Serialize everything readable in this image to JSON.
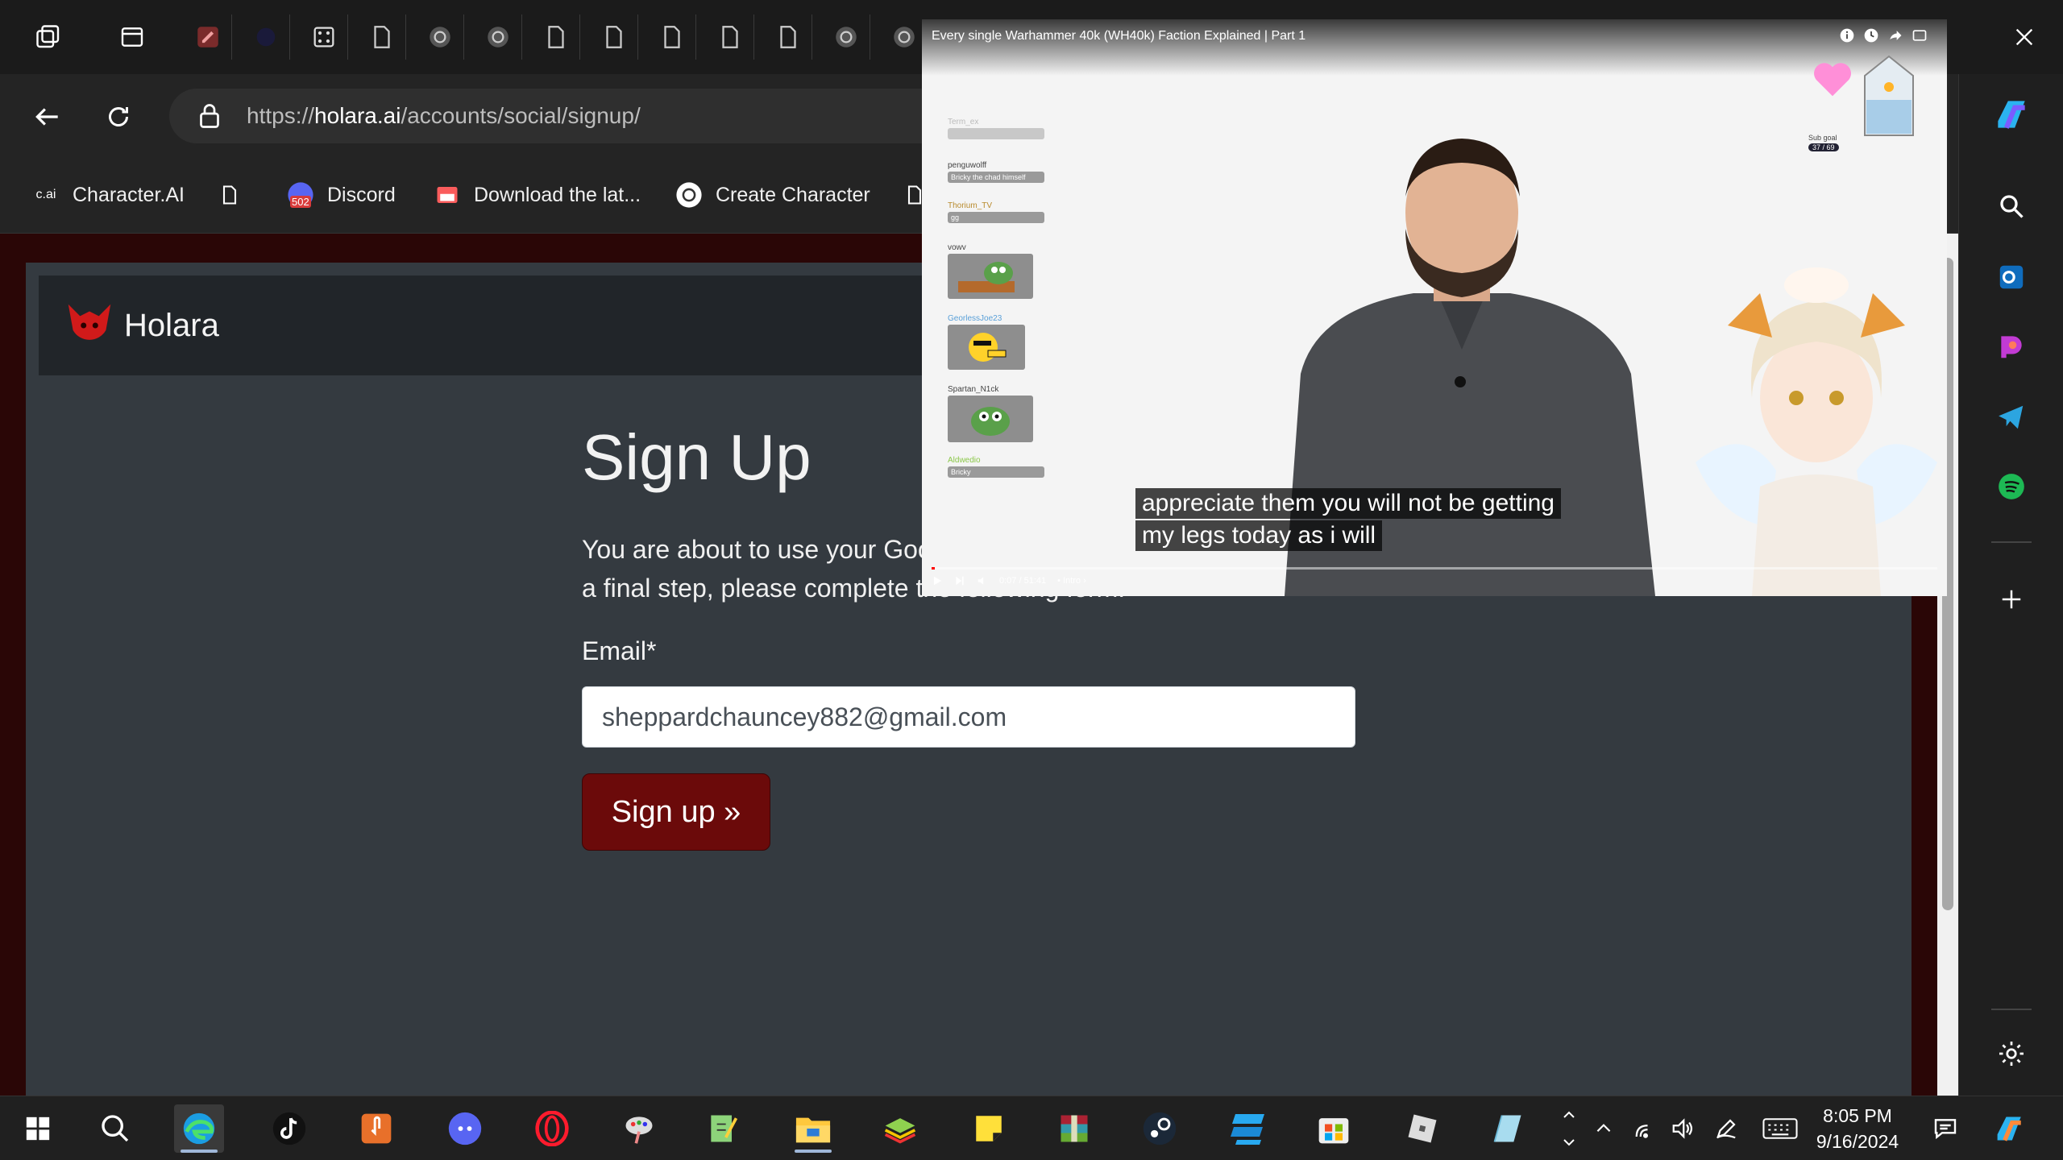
{
  "browser": {
    "url_scheme": "https://",
    "url_host": "holara.ai",
    "url_path": "/accounts/social/signup/",
    "favorites": [
      {
        "label": "Character.AI",
        "icon": "c.ai"
      },
      {
        "label": "Discord",
        "badge": "502"
      },
      {
        "label": "Download the lat..."
      },
      {
        "label": "Create Character"
      }
    ]
  },
  "site": {
    "brand": "Holara",
    "title": "Sign Up",
    "intro_line1": "You are about to use your Goo",
    "intro_line2": "a final step, please complete the following form:",
    "email_label": "Email*",
    "email_value": "sheppardchauncey882@gmail.com",
    "submit_label": "Sign up »"
  },
  "pip": {
    "title": "Every single Warhammer 40k (WH40k) Faction Explained | Part 1",
    "subtitle_line1": "appreciate them you will not be getting",
    "subtitle_line2": "my legs today as i will",
    "time": "0:07 / 51:41",
    "chapter": "• Intro ›",
    "progress_fraction": 0.002,
    "sub_goal_label": "Sub goal",
    "sub_goal_value": "37 / 69",
    "chat": [
      {
        "name": "Term_ex",
        "msg": ""
      },
      {
        "name": "penguwolff",
        "msg": "Bricky the chad himself"
      },
      {
        "name": "Thorium_TV",
        "msg": "gg"
      },
      {
        "name": "vowv",
        "emote": "pepe-desk"
      },
      {
        "name": "GeorlessJoe23",
        "emote": "pointing-face"
      },
      {
        "name": "Spartan_N1ck",
        "emote": "pepe-eyes"
      },
      {
        "name": "Aldwedio",
        "msg": "Bricky"
      }
    ]
  },
  "taskbar": {
    "time": "8:05 PM",
    "date": "9/16/2024"
  },
  "colors": {
    "accent_button": "#6b0a0a",
    "page_bg": "#343a40",
    "header_bg": "#212529"
  }
}
